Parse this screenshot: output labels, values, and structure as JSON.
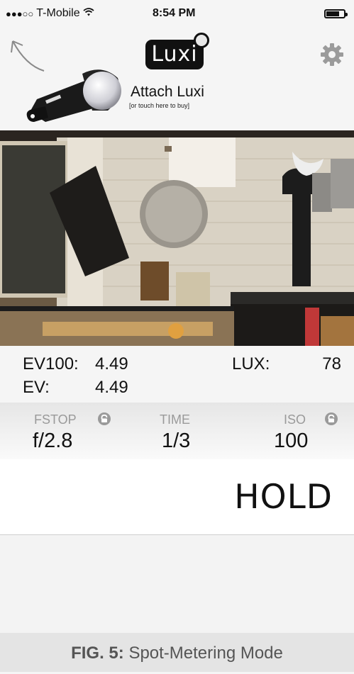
{
  "status_bar": {
    "signal_dots": "●●●○○",
    "carrier": "T-Mobile",
    "wifi_icon": "wifi-icon",
    "time": "8:54 PM",
    "battery_icon": "battery-icon"
  },
  "header": {
    "logo_text": "Luxi",
    "attach_title": "Attach Luxi",
    "attach_subtitle": "[or touch here to buy]",
    "back_icon": "curved-arrow-icon",
    "settings_icon": "gear-icon"
  },
  "readings": {
    "ev100_label": "EV100:",
    "ev100_value": "4.49",
    "ev_label": "EV:",
    "ev_value": "4.49",
    "lux_label": "LUX:",
    "lux_value": "78"
  },
  "exposure": {
    "fstop_label": "FSTOP",
    "fstop_value": "f/2.8",
    "time_label": "TIME",
    "time_value": "1/3",
    "iso_label": "ISO",
    "iso_value": "100"
  },
  "hold_button": {
    "label": "HOLD"
  },
  "caption": {
    "figure": "FIG. 5:",
    "text": "Spot-Metering Mode"
  }
}
